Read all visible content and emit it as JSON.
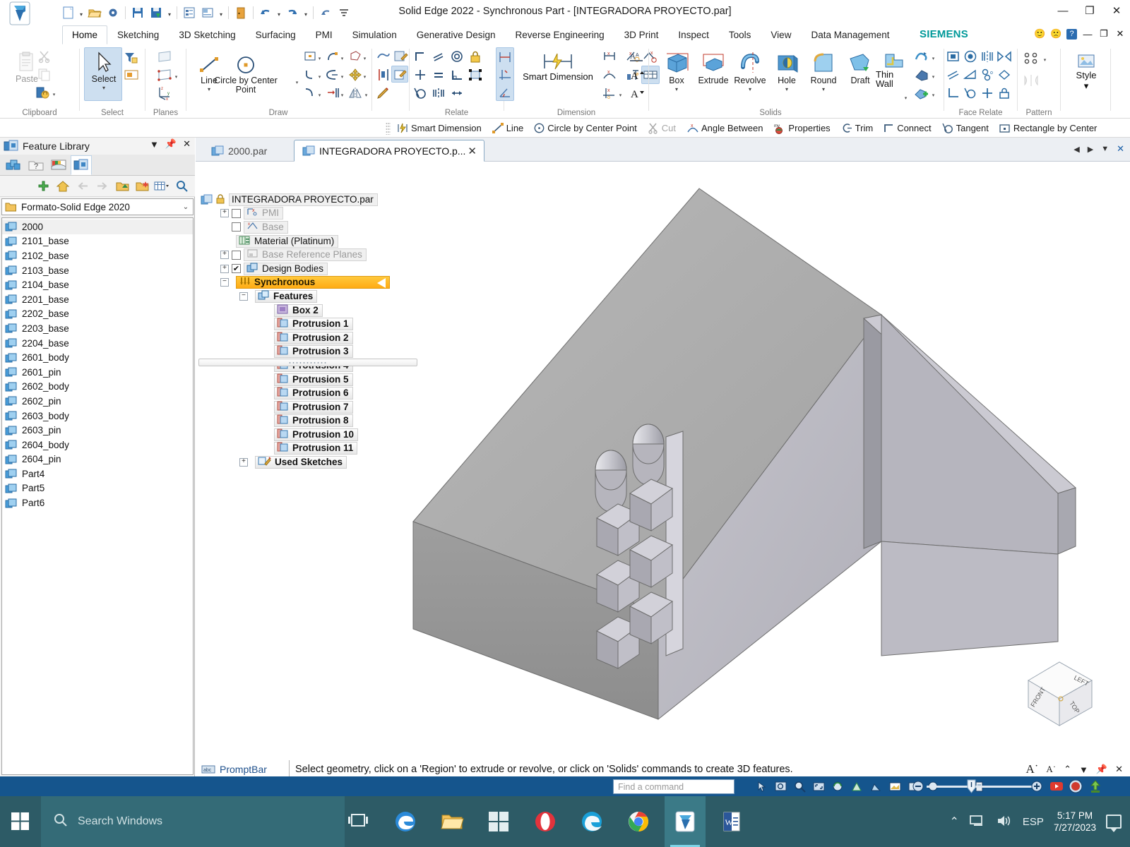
{
  "window": {
    "title": "Solid Edge 2022 - Synchronous Part - [INTEGRADORA PROYECTO.par]",
    "minimize": "—",
    "restore": "❐",
    "close": "✕"
  },
  "quick_access": {
    "items": [
      {
        "name": "new-document-icon",
        "label": "New"
      },
      {
        "name": "open-document-icon",
        "label": "Open"
      },
      {
        "name": "recent-documents-icon",
        "label": "Recent"
      },
      {
        "name": "save-icon",
        "label": "Save"
      },
      {
        "name": "save-as-icon",
        "label": "Save As"
      },
      {
        "name": "properties-icon",
        "label": "Properties"
      },
      {
        "name": "print-preview-icon",
        "label": "Print Preview"
      },
      {
        "name": "exit-icon",
        "label": "Exit"
      },
      {
        "name": "undo-icon",
        "label": "Undo"
      },
      {
        "name": "redo-icon",
        "label": "Redo"
      },
      {
        "name": "repeat-icon",
        "label": "Repeat"
      },
      {
        "name": "customize-qat-icon",
        "label": "Customize Quick Access Toolbar"
      }
    ]
  },
  "ribbon": {
    "tabs": [
      {
        "label": "Home",
        "active": true
      },
      {
        "label": "Sketching",
        "active": false
      },
      {
        "label": "3D Sketching",
        "active": false
      },
      {
        "label": "Surfacing",
        "active": false
      },
      {
        "label": "PMI",
        "active": false
      },
      {
        "label": "Simulation",
        "active": false
      },
      {
        "label": "Generative Design",
        "active": false
      },
      {
        "label": "Reverse Engineering",
        "active": false
      },
      {
        "label": "3D Print",
        "active": false
      },
      {
        "label": "Inspect",
        "active": false
      },
      {
        "label": "Tools",
        "active": false
      },
      {
        "label": "View",
        "active": false
      },
      {
        "label": "Data Management",
        "active": false
      }
    ],
    "brand": "SIEMENS",
    "groups": {
      "clipboard": {
        "label": "Clipboard",
        "paste": "Paste"
      },
      "select": {
        "label": "Select",
        "select": "Select"
      },
      "planes": {
        "label": "Planes"
      },
      "draw": {
        "label": "Draw",
        "line": "Line",
        "circle_by_center_point": "Circle by Center Point"
      },
      "relate": {
        "label": "Relate"
      },
      "dimension": {
        "label": "Dimension",
        "smart_dimension": "Smart Dimension"
      },
      "solids": {
        "label": "Solids",
        "box": "Box",
        "extrude": "Extrude",
        "revolve": "Revolve",
        "hole": "Hole",
        "round": "Round",
        "draft": "Draft",
        "thin_wall": "Thin Wall"
      },
      "face_relate": {
        "label": "Face Relate"
      },
      "pattern": {
        "label": "Pattern"
      },
      "style": {
        "label": "Style",
        "style": "Style"
      }
    }
  },
  "command_bar": {
    "items": [
      {
        "label": "Smart Dimension",
        "icon": "smart-dimension-icon",
        "disabled": false
      },
      {
        "label": "Line",
        "icon": "line-icon",
        "disabled": false
      },
      {
        "label": "Circle by Center Point",
        "icon": "circle-center-icon",
        "disabled": false
      },
      {
        "label": "Cut",
        "icon": "cut-icon",
        "disabled": true
      },
      {
        "label": "Angle Between",
        "icon": "angle-between-icon",
        "disabled": false
      },
      {
        "label": "Properties",
        "icon": "properties-icon",
        "disabled": false
      },
      {
        "label": "Trim",
        "icon": "trim-icon",
        "disabled": false
      },
      {
        "label": "Connect",
        "icon": "connect-icon",
        "disabled": false
      },
      {
        "label": "Tangent",
        "icon": "tangent-icon",
        "disabled": false
      },
      {
        "label": "Rectangle by Center",
        "icon": "rectangle-center-icon",
        "disabled": false
      }
    ]
  },
  "feature_library": {
    "title": "Feature Library",
    "panel_buttons": [
      "menu-icon",
      "pin-icon",
      "close-icon"
    ],
    "tabs": [
      {
        "name": "assembly-pathfinder-tab",
        "active": false
      },
      {
        "name": "unknown-tab",
        "active": false
      },
      {
        "name": "parts-library-tab",
        "active": false
      },
      {
        "name": "feature-library-tab",
        "active": true
      }
    ],
    "toolbar": [
      {
        "name": "add-icon"
      },
      {
        "name": "home-icon"
      },
      {
        "name": "back-icon"
      },
      {
        "name": "forward-icon"
      },
      {
        "name": "up-folder-icon"
      },
      {
        "name": "new-folder-icon"
      },
      {
        "name": "view-mode-icon"
      },
      {
        "name": "search-icon"
      }
    ],
    "folder": "Formato-Solid Edge 2020",
    "items": [
      "2000",
      "2101_base",
      "2102_base",
      "2103_base",
      "2104_base",
      "2201_base",
      "2202_base",
      "2203_base",
      "2204_base",
      "2601_body",
      "2601_pin",
      "2602_body",
      "2602_pin",
      "2603_body",
      "2603_pin",
      "2604_body",
      "2604_pin",
      "Part4",
      "Part5",
      "Part6"
    ]
  },
  "document_tabs": [
    {
      "label": "2000.par",
      "active": false
    },
    {
      "label": "INTEGRADORA PROYECTO.p...",
      "active": true
    }
  ],
  "feature_tree": {
    "root": "INTEGRADORA PROYECTO.par",
    "nodes": [
      {
        "label": "PMI",
        "indent": 1,
        "expander": "+",
        "checkbox": "empty",
        "gray": true,
        "icon": "pmi-icon"
      },
      {
        "label": "Base",
        "indent": 1,
        "expander": "",
        "checkbox": "empty",
        "gray": true,
        "icon": "base-icon"
      },
      {
        "label": "Material (Platinum)",
        "indent": 1,
        "expander": "",
        "checkbox": "none",
        "gray": false,
        "icon": "material-icon"
      },
      {
        "label": "Base Reference Planes",
        "indent": 1,
        "expander": "+",
        "checkbox": "empty",
        "gray": true,
        "icon": "reference-planes-icon"
      },
      {
        "label": "Design Bodies",
        "indent": 1,
        "expander": "+",
        "checkbox": "checked",
        "gray": false,
        "icon": "design-bodies-icon"
      },
      {
        "label": "Synchronous",
        "indent": 1,
        "expander": "−",
        "checkbox": "none",
        "gray": false,
        "icon": "synchronous-icon",
        "highlight": true
      },
      {
        "label": "Features",
        "indent": 2,
        "expander": "−",
        "checkbox": "none",
        "gray": false,
        "icon": "features-icon",
        "bold": true
      },
      {
        "label": "Box 2",
        "indent": 3,
        "expander": "",
        "checkbox": "none",
        "gray": false,
        "icon": "box-feature-icon",
        "bold": true
      },
      {
        "label": "Protrusion 1",
        "indent": 3,
        "expander": "",
        "checkbox": "none",
        "gray": false,
        "icon": "protrusion-icon",
        "bold": true
      },
      {
        "label": "Protrusion 2",
        "indent": 3,
        "expander": "",
        "checkbox": "none",
        "gray": false,
        "icon": "protrusion-icon",
        "bold": true
      },
      {
        "label": "Protrusion 3",
        "indent": 3,
        "expander": "",
        "checkbox": "none",
        "gray": false,
        "icon": "protrusion-icon",
        "bold": true
      },
      {
        "label": "Protrusion 4",
        "indent": 3,
        "expander": "",
        "checkbox": "none",
        "gray": false,
        "icon": "protrusion-icon",
        "bold": true
      },
      {
        "label": "Protrusion 5",
        "indent": 3,
        "expander": "",
        "checkbox": "none",
        "gray": false,
        "icon": "protrusion-icon",
        "bold": true
      },
      {
        "label": "Protrusion 6",
        "indent": 3,
        "expander": "",
        "checkbox": "none",
        "gray": false,
        "icon": "protrusion-icon",
        "bold": true
      },
      {
        "label": "Protrusion 7",
        "indent": 3,
        "expander": "",
        "checkbox": "none",
        "gray": false,
        "icon": "protrusion-icon",
        "bold": true
      },
      {
        "label": "Protrusion 8",
        "indent": 3,
        "expander": "",
        "checkbox": "none",
        "gray": false,
        "icon": "protrusion-icon",
        "bold": true
      },
      {
        "label": "Protrusion 10",
        "indent": 3,
        "expander": "",
        "checkbox": "none",
        "gray": false,
        "icon": "protrusion-icon",
        "bold": true
      },
      {
        "label": "Protrusion 11",
        "indent": 3,
        "expander": "",
        "checkbox": "none",
        "gray": false,
        "icon": "protrusion-icon",
        "bold": true
      },
      {
        "label": "Used Sketches",
        "indent": 2,
        "expander": "+",
        "checkbox": "none",
        "gray": false,
        "icon": "used-sketches-icon",
        "bold": true
      }
    ]
  },
  "view_cube": {
    "faces": [
      "FRONT",
      "TOP",
      "LEFT"
    ]
  },
  "prompt_bar": {
    "label": "PromptBar",
    "message": "Select geometry, click on a 'Region' to extrude or revolve, or click on 'Solids' commands to create 3D features.",
    "buttons": [
      "increase-font-icon",
      "decrease-font-icon",
      "collapse-icon",
      "menu-icon",
      "pin-icon",
      "close-icon"
    ]
  },
  "status_bar": {
    "find_command_placeholder": "Find a command",
    "icons": [
      "select-tool-icon",
      "zoom-area-icon",
      "zoom-icon",
      "fit-icon",
      "rotate-icon",
      "sketch-view-icon",
      "shading-icon",
      "view-styles-icon",
      "window-icon",
      "zoom-out-icon",
      "part-painter-icon"
    ],
    "zoom_out": "−",
    "zoom_in": "+"
  },
  "taskbar": {
    "search_placeholder": "Search Windows",
    "apps": [
      {
        "name": "task-view-icon"
      },
      {
        "name": "edge-legacy-icon"
      },
      {
        "name": "file-explorer-icon"
      },
      {
        "name": "microsoft-store-icon"
      },
      {
        "name": "opera-icon"
      },
      {
        "name": "edge-icon"
      },
      {
        "name": "chrome-icon"
      },
      {
        "name": "solid-edge-icon",
        "active": true
      },
      {
        "name": "word-icon"
      }
    ],
    "tray": {
      "show_hidden": "⌃",
      "network": "network-icon",
      "volume": "volume-icon",
      "language": "ESP",
      "time": "5:17 PM",
      "date": "7/27/2023",
      "action_center": "notification-icon"
    }
  }
}
